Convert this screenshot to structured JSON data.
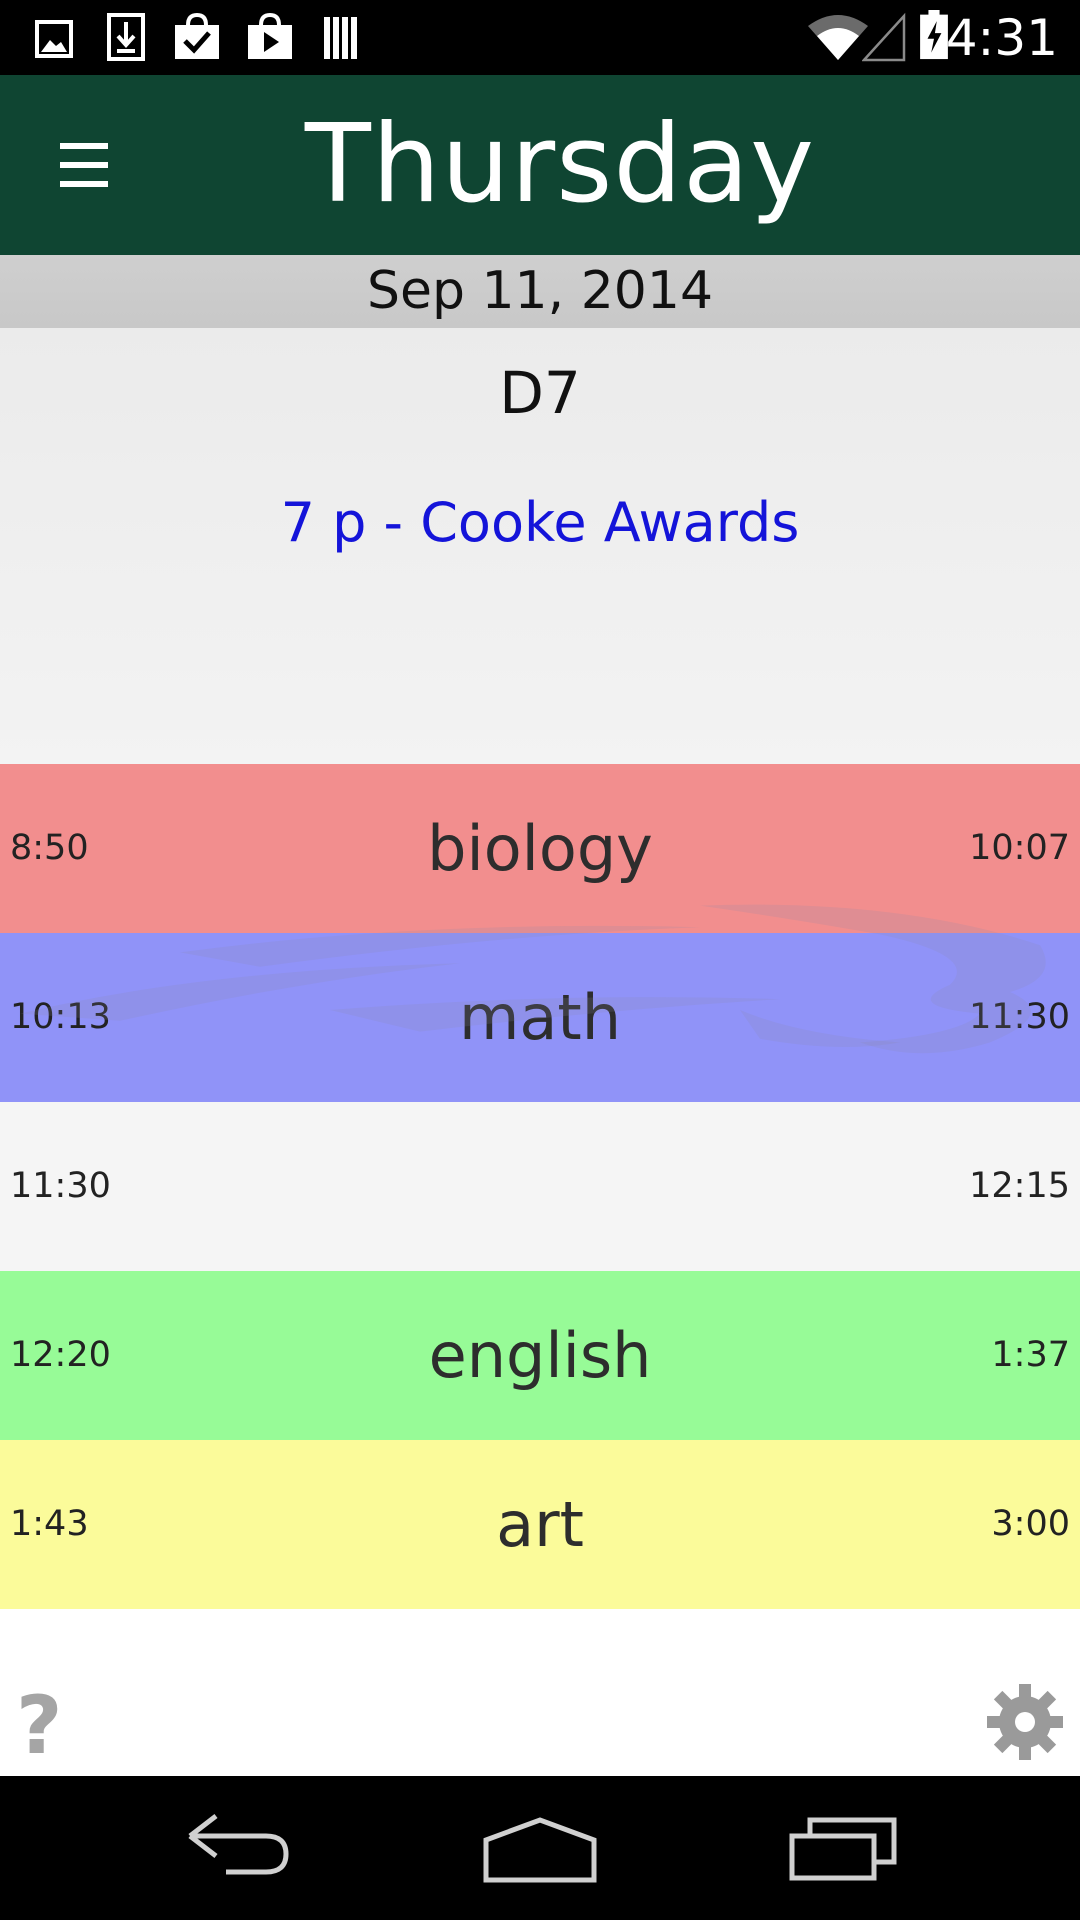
{
  "status_bar": {
    "time": "4:31",
    "icons": [
      "gallery-icon",
      "download-icon",
      "shopping-bag-icon",
      "play-store-icon",
      "books-icon",
      "wifi-icon",
      "signal-icon",
      "battery-charging-icon"
    ]
  },
  "header": {
    "title": "Thursday",
    "menu_icon": "menu-icon",
    "color": "#0f4532"
  },
  "date": "Sep 11, 2014",
  "day_info": {
    "code": "D7",
    "event": "7 p - Cooke Awards"
  },
  "schedule": [
    {
      "start": "8:50",
      "name": "biology",
      "end": "10:07",
      "color": "#f28e8e"
    },
    {
      "start": "10:13",
      "name": "math",
      "end": "11:30",
      "color": "#9093f8"
    },
    {
      "start": "11:30",
      "name": "",
      "end": "12:15",
      "color": "#f5f5f5"
    },
    {
      "start": "12:20",
      "name": "english",
      "end": "1:37",
      "color": "#97fb97"
    },
    {
      "start": "1:43",
      "name": "art",
      "end": "3:00",
      "color": "#fbfb9a"
    }
  ],
  "footer": {
    "help_label": "?",
    "settings_icon": "gear-icon"
  },
  "nav_bar": {
    "icons": [
      "back-icon",
      "home-icon",
      "recent-apps-icon"
    ]
  }
}
